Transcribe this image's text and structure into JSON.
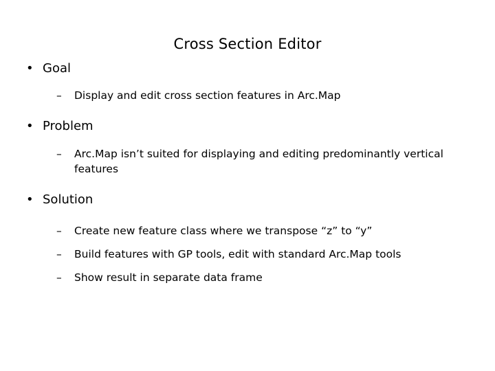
{
  "slide": {
    "title": "Cross Section Editor",
    "bullet_marker": "•",
    "dash_marker": "–",
    "items": [
      {
        "level": 1,
        "text": "Goal"
      },
      {
        "level": 2,
        "text": "Display and edit cross section features in Arc.Map"
      },
      {
        "level": 1,
        "text": "Problem"
      },
      {
        "level": 2,
        "text": "Arc.Map isn’t suited for displaying and editing predominantly vertical features"
      },
      {
        "level": 1,
        "text": "Solution"
      },
      {
        "level": 2,
        "text": "Create new feature class where we transpose “z” to “y”"
      },
      {
        "level": 2,
        "text": "Build features with GP tools, edit with standard Arc.Map tools"
      },
      {
        "level": 2,
        "text": "Show result in separate data frame"
      }
    ]
  }
}
